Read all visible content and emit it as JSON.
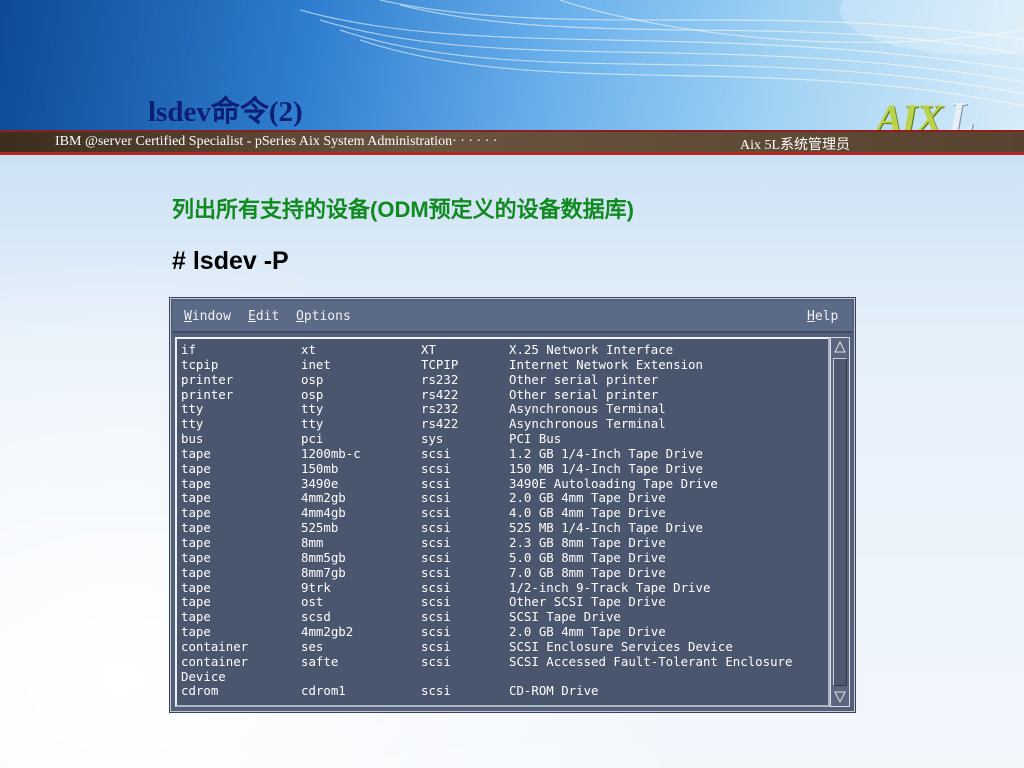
{
  "slide": {
    "title": "lsdev命令(2)",
    "logo_main": "AIX",
    "logo_suffix": "L",
    "subtitle_left": "IBM @server Certified Specialist - pSeries Aix System Administration· · · · · ·",
    "subtitle_right": "Aix 5L系统管理员",
    "heading": "列出所有支持的设备(ODM预定义的设备数据库)",
    "command": "# lsdev -P"
  },
  "window": {
    "menu": {
      "window": {
        "underline": "W",
        "rest": "indow"
      },
      "edit": {
        "underline": "E",
        "rest": "dit"
      },
      "options": {
        "underline": "O",
        "rest": "ptions"
      },
      "help": {
        "underline": "H",
        "rest": "elp"
      }
    },
    "rows": [
      [
        "if",
        "xt",
        "XT",
        "X.25 Network Interface"
      ],
      [
        "tcpip",
        "inet",
        "TCPIP",
        "Internet Network Extension"
      ],
      [
        "printer",
        "osp",
        "rs232",
        "Other serial printer"
      ],
      [
        "printer",
        "osp",
        "rs422",
        "Other serial printer"
      ],
      [
        "tty",
        "tty",
        "rs232",
        "Asynchronous Terminal"
      ],
      [
        "tty",
        "tty",
        "rs422",
        "Asynchronous Terminal"
      ],
      [
        "bus",
        "pci",
        "sys",
        "PCI Bus"
      ],
      [
        "tape",
        "1200mb-c",
        "scsi",
        "1.2 GB 1/4-Inch Tape Drive"
      ],
      [
        "tape",
        "150mb",
        "scsi",
        "150 MB 1/4-Inch Tape Drive"
      ],
      [
        "tape",
        "3490e",
        "scsi",
        "3490E Autoloading Tape Drive"
      ],
      [
        "tape",
        "4mm2gb",
        "scsi",
        "2.0 GB 4mm Tape Drive"
      ],
      [
        "tape",
        "4mm4gb",
        "scsi",
        "4.0 GB 4mm Tape Drive"
      ],
      [
        "tape",
        "525mb",
        "scsi",
        "525 MB 1/4-Inch Tape Drive"
      ],
      [
        "tape",
        "8mm",
        "scsi",
        "2.3 GB 8mm Tape Drive"
      ],
      [
        "tape",
        "8mm5gb",
        "scsi",
        "5.0 GB 8mm Tape Drive"
      ],
      [
        "tape",
        "8mm7gb",
        "scsi",
        "7.0 GB 8mm Tape Drive"
      ],
      [
        "tape",
        "9trk",
        "scsi",
        "1/2-inch 9-Track Tape Drive"
      ],
      [
        "tape",
        "ost",
        "scsi",
        "Other SCSI Tape Drive"
      ],
      [
        "tape",
        "scsd",
        "scsi",
        "SCSI Tape Drive"
      ],
      [
        "tape",
        "4mm2gb2",
        "scsi",
        "2.0 GB 4mm Tape Drive"
      ],
      [
        "container",
        "ses",
        "scsi",
        "SCSI Enclosure Services Device"
      ],
      [
        "container",
        "safte",
        "scsi",
        "SCSI Accessed Fault-Tolerant Enclosure"
      ],
      [
        "Device",
        "",
        "",
        ""
      ],
      [
        "cdrom",
        "cdrom1",
        "scsi",
        "CD-ROM Drive"
      ]
    ]
  },
  "colors": {
    "title": "#0b1f74",
    "heading": "#0f8a1e",
    "terminal_bg": "#4a566e",
    "terminal_text": "#ffffff"
  }
}
